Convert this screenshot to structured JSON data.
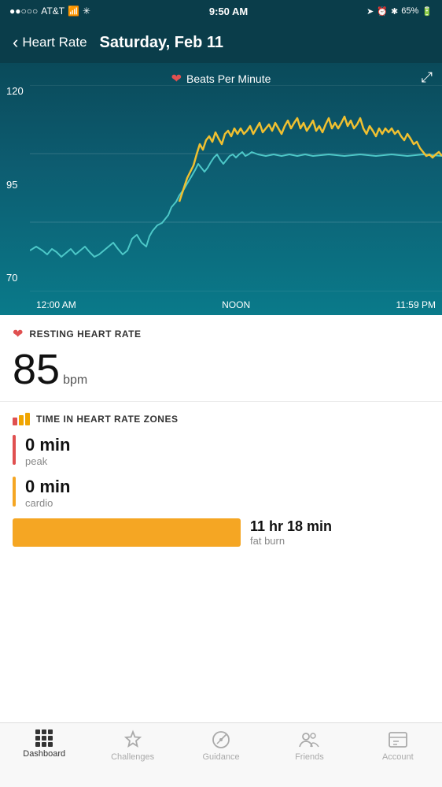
{
  "statusBar": {
    "carrier": "AT&T",
    "time": "9:50 AM",
    "battery": "65%"
  },
  "nav": {
    "backLabel": "Heart Rate",
    "title": "Saturday, Feb 11"
  },
  "chart": {
    "legend": "Beats Per Minute",
    "yLabels": [
      "120",
      "95",
      "70"
    ],
    "xLabels": [
      "12:00 AM",
      "NOON",
      "11:59 PM"
    ],
    "expandLabel": "⤢"
  },
  "restingHR": {
    "sectionTitle": "RESTING HEART RATE",
    "value": "85",
    "unit": "bpm"
  },
  "zones": {
    "sectionTitle": "TIME IN HEART RATE ZONES",
    "peak": {
      "value": "0 min",
      "label": "peak"
    },
    "cardio": {
      "value": "0 min",
      "label": "cardio"
    },
    "fatBurn": {
      "value": "11 hr 18 min",
      "label": "fat burn"
    }
  },
  "tabBar": {
    "items": [
      {
        "id": "dashboard",
        "label": "Dashboard",
        "active": true
      },
      {
        "id": "challenges",
        "label": "Challenges",
        "active": false
      },
      {
        "id": "guidance",
        "label": "Guidance",
        "active": false
      },
      {
        "id": "friends",
        "label": "Friends",
        "active": false
      },
      {
        "id": "account",
        "label": "Account",
        "active": false
      }
    ]
  }
}
